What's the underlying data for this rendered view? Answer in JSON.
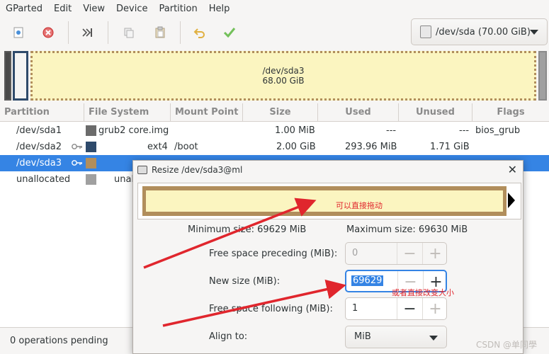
{
  "menu": [
    "GParted",
    "Edit",
    "View",
    "Device",
    "Partition",
    "Help"
  ],
  "device_selector": {
    "label": "/dev/sda (70.00 GiB)"
  },
  "disk_map": {
    "selected_name": "/dev/sda3",
    "selected_size": "68.00 GiB"
  },
  "table": {
    "headers": [
      "Partition",
      "File System",
      "Mount Point",
      "Size",
      "Used",
      "Unused",
      "Flags"
    ],
    "rows": [
      {
        "partition": "/dev/sda1",
        "fs": "grub2 core.img",
        "mount": "",
        "size": "1.00 MiB",
        "used": "---",
        "unused": "---",
        "flags": "bios_grub",
        "color": "#6b6b6b",
        "locked": false
      },
      {
        "partition": "/dev/sda2",
        "fs": "ext4",
        "mount": "/boot",
        "size": "2.00 GiB",
        "used": "293.96 MiB",
        "unused": "1.71 GiB",
        "flags": "",
        "color": "#2e4a6b",
        "locked": true
      },
      {
        "partition": "/dev/sda3",
        "fs": "",
        "mount": "",
        "size": "",
        "used": "",
        "unused": "",
        "flags": "",
        "color": "#b18e5c",
        "locked": true
      },
      {
        "partition": "unallocated",
        "fs": "unal",
        "mount": "",
        "size": "",
        "used": "",
        "unused": "",
        "flags": "",
        "color": "#a0a0a0",
        "locked": false
      }
    ]
  },
  "status": {
    "text": "0 operations pending"
  },
  "dialog": {
    "title": "Resize /dev/sda3@ml",
    "min_size": "Minimum size: 69629 MiB",
    "max_size": "Maximum size: 69630 MiB",
    "free_preceding_label": "Free space preceding (MiB):",
    "free_preceding_value": "0",
    "new_size_label": "New size (MiB):",
    "new_size_value": "69629",
    "free_following_label": "Free space following (MiB):",
    "free_following_value": "1",
    "align_label": "Align to:",
    "align_value": "MiB"
  },
  "annotations": {
    "drag": "可以直接拖动",
    "type": "或者直接改变大小"
  },
  "watermark": "CSDN @单同學",
  "colors": {
    "selected_row": "#3584e4",
    "annotation": "#e0262d",
    "partition_fill": "#fbf5c0",
    "ext4_border": "#2e4a6b"
  }
}
